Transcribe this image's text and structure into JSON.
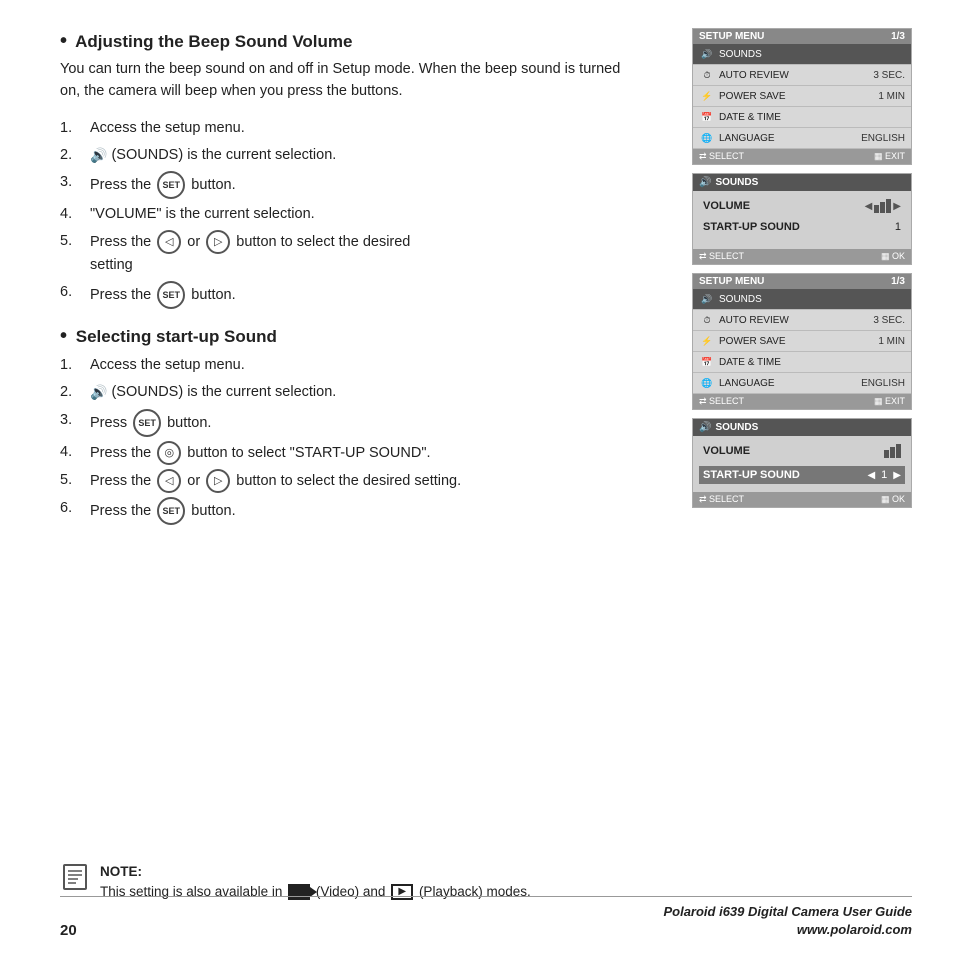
{
  "page": {
    "number": "20",
    "footer_title_line1": "Polaroid i639 Digital Camera User Guide",
    "footer_title_line2": "www.polaroid.com"
  },
  "section1": {
    "heading": "Adjusting the Beep Sound Volume",
    "intro": "You can turn the beep sound on and off in Setup mode. When the beep sound is turned on, the camera will beep when you press the buttons.",
    "steps": [
      {
        "num": "1.",
        "text": "Access the setup menu."
      },
      {
        "num": "2.",
        "text": "(SOUNDS) is the current selection."
      },
      {
        "num": "3.",
        "text": "Press the  button."
      },
      {
        "num": "4.",
        "text": "\"VOLUME\" is the current selection."
      },
      {
        "num": "5.",
        "text": "Press the  or  button to select the desired setting"
      },
      {
        "num": "6.",
        "text": "Press the  button."
      }
    ],
    "step2_prefix": "🔊",
    "set_label": "SET",
    "dial_left": "◁",
    "dial_right": "▷"
  },
  "section2": {
    "heading": "Selecting start-up Sound",
    "steps": [
      {
        "num": "1.",
        "text": "Access the setup menu."
      },
      {
        "num": "2.",
        "text": "(SOUNDS) is the current selection."
      },
      {
        "num": "3.",
        "text": "Press  button."
      },
      {
        "num": "4.",
        "text": "Press the  button to select \"START-UP SOUND\"."
      },
      {
        "num": "5.",
        "text": "Press the  or  button to select the desired setting."
      },
      {
        "num": "6.",
        "text": "Press the  button."
      }
    ]
  },
  "note": {
    "label": "NOTE:",
    "text": "This setting is also available in  (Video) and  (Playback) modes."
  },
  "panel1": {
    "header_left": "SETUP MENU",
    "header_right": "1/3",
    "rows": [
      {
        "icon": "🔊",
        "label": "SOUNDS",
        "value": "",
        "selected": true
      },
      {
        "icon": "⏱",
        "label": "AUTO REVIEW",
        "value": "3 SEC.",
        "selected": false
      },
      {
        "icon": "⚡",
        "label": "POWER SAVE",
        "value": "1 MIN",
        "selected": false
      },
      {
        "icon": "📅",
        "label": "DATE & TIME",
        "value": "",
        "selected": false
      },
      {
        "icon": "🌐",
        "label": "LANGUAGE",
        "value": "ENGLISH",
        "selected": false
      }
    ],
    "footer_left": "SELECT",
    "footer_right": "EXIT"
  },
  "panel2": {
    "header": "SOUNDS",
    "volume_label": "VOLUME",
    "startup_label": "START-UP SOUND",
    "startup_value": "1",
    "footer_left": "SELECT",
    "footer_right": "OK"
  },
  "panel3": {
    "header_left": "SETUP MENU",
    "header_right": "1/3",
    "rows": [
      {
        "icon": "🔊",
        "label": "SOUNDS",
        "value": "",
        "selected": true
      },
      {
        "icon": "⏱",
        "label": "AUTO REVIEW",
        "value": "3 SEC.",
        "selected": false
      },
      {
        "icon": "⚡",
        "label": "POWER SAVE",
        "value": "1 MIN",
        "selected": false
      },
      {
        "icon": "📅",
        "label": "DATE & TIME",
        "value": "",
        "selected": false
      },
      {
        "icon": "🌐",
        "label": "LANGUAGE",
        "value": "ENGLISH",
        "selected": false
      }
    ],
    "footer_left": "SELECT",
    "footer_right": "EXIT"
  },
  "panel4": {
    "header": "SOUNDS",
    "volume_label": "VOLUME",
    "startup_label": "START-UP SOUND",
    "startup_value": "1",
    "footer_left": "SELECT",
    "footer_right": "OK"
  }
}
